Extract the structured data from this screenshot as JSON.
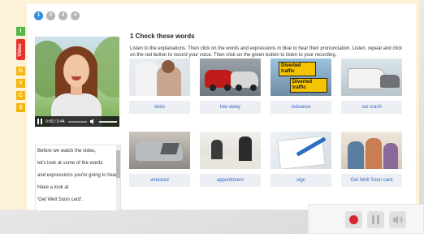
{
  "pagination": {
    "pages": [
      "1",
      "2",
      "3",
      "4"
    ],
    "active_index": 0
  },
  "side_tabs": [
    {
      "label": "I",
      "color": "#52b848"
    },
    {
      "label": "Video",
      "color": "#e8322c"
    },
    {
      "label": "G",
      "color": "#f5b60f"
    },
    {
      "label": "V",
      "color": "#f5b60f"
    },
    {
      "label": "C",
      "color": "#f5b60f"
    },
    {
      "label": "S",
      "color": "#f5b60f"
    }
  ],
  "video": {
    "time": "0:00 / 0:44",
    "progress": 0.0
  },
  "transcript": [
    "Before we watch the video,",
    "let's look at some of the words",
    "and expressions you're going to hear.",
    "Have a look at",
    "'Get Well Soon card'."
  ],
  "exercise": {
    "title": "1 Check these words",
    "instructions": "Listen to the explanations. Then click on the words and expressions in blue to hear their pronunciation. Listen, repeat and click on the red button to record your voice. Then click on the green button to listen to your recording."
  },
  "cards": [
    {
      "label": "tests"
    },
    {
      "label": "tow away"
    },
    {
      "label": "nuisance",
      "sign_lines": [
        "Diverted",
        "traffic"
      ]
    },
    {
      "label": "car crash"
    },
    {
      "label": "wrecked"
    },
    {
      "label": "appointment"
    },
    {
      "label": "sign"
    },
    {
      "label": "Get Well Soon card"
    }
  ],
  "recorder": {
    "record_color": "#d7262a"
  }
}
